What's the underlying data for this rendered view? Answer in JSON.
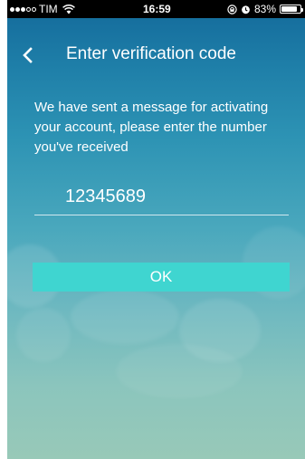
{
  "status_bar": {
    "signal_strength": "3 of 5",
    "carrier": "TIM",
    "time": "16:59",
    "battery_percent": "83%",
    "battery_level": 0.83,
    "icons": [
      "wifi-icon",
      "location-lock-icon",
      "alarm-icon",
      "battery-icon"
    ]
  },
  "header": {
    "title": "Enter verification code",
    "back_icon": "chevron-left-icon"
  },
  "message": "We have sent a message for activating your account, please enter the number you've received",
  "verification_input": {
    "value": "12345689"
  },
  "ok_button": {
    "label": "OK",
    "color": "#3fd5d0"
  },
  "colors": {
    "background_top": "#13699a",
    "background_bottom": "#98c9b8",
    "text": "#ffffff"
  }
}
